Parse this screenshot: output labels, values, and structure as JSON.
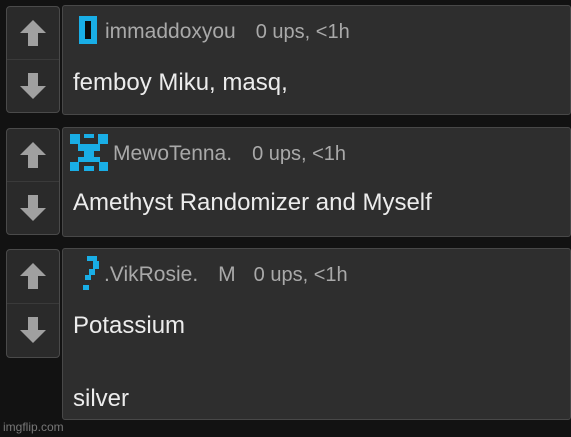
{
  "comments": [
    {
      "username": "immaddoxyou",
      "mod_badge": "",
      "meta": "0 ups, <1h",
      "lines": [
        "femboy Miku, masq,"
      ],
      "avatar_icon": "cyan-bar-avatar-icon"
    },
    {
      "username": "MewoTenna.",
      "mod_badge": "",
      "meta": "0 ups, <1h",
      "lines": [
        "Amethyst Randomizer and Myself"
      ],
      "avatar_icon": "cyan-pixel-avatar-icon"
    },
    {
      "username": ".VikRosie.",
      "mod_badge": "M",
      "meta": "0 ups, <1h",
      "lines": [
        "Potassium",
        "silver"
      ],
      "avatar_icon": "cyan-question-avatar-icon"
    }
  ],
  "footer": {
    "watermark": "imgflip.com"
  },
  "colors": {
    "background": "#121212",
    "panel": "#2e2e2e",
    "vote_panel": "#2a2a2a",
    "avatar": "#19aee6",
    "text": "#ececec",
    "meta": "#a9a9a9",
    "arrow": "#a0a0a0"
  }
}
